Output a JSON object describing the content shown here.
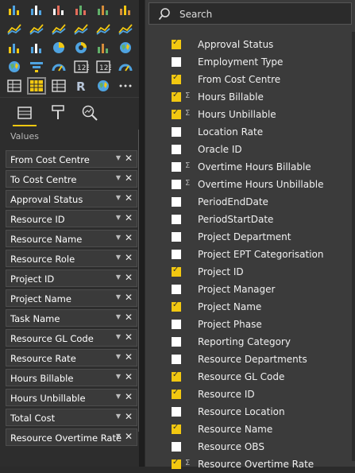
{
  "visualizations": [
    "stacked-bar-icon",
    "clustered-bar-icon",
    "stacked-bar-100-icon",
    "clustered-column-icon",
    "stacked-column-100-icon",
    "clustered-column-2-icon",
    "line-icon",
    "area-icon",
    "stacked-area-icon",
    "line-column-icon",
    "line-stacked-column-icon",
    "ribbon-icon",
    "waterfall-icon",
    "scatter-icon",
    "pie-icon",
    "donut-icon",
    "treemap-icon",
    "map-icon",
    "filled-map-icon",
    "funnel-icon",
    "gauge-icon",
    "card-icon",
    "multirow-card-icon",
    "kpi-icon",
    "slicer-icon",
    "table-icon",
    "matrix-icon",
    "r-script-icon",
    "globe-icon",
    "more-icon"
  ],
  "tabs": [
    "fields-tab-icon",
    "format-tab-icon",
    "analytics-tab-icon"
  ],
  "values_label": "Values",
  "wells": [
    "From Cost Centre",
    "To Cost Centre",
    "Approval Status",
    "Resource ID",
    "Resource Name",
    "Resource Role",
    "Project ID",
    "Project Name",
    "Task Name",
    "Resource GL Code",
    "Resource Rate",
    "Hours Billable",
    "Hours Unbillable",
    "Total Cost",
    "Resource Overtime Rate"
  ],
  "search": {
    "placeholder": "Search"
  },
  "fields": [
    {
      "label": "Approval Status",
      "checked": true,
      "sigma": false
    },
    {
      "label": "Employment Type",
      "checked": false,
      "sigma": false
    },
    {
      "label": "From Cost Centre",
      "checked": true,
      "sigma": false
    },
    {
      "label": "Hours Billable",
      "checked": true,
      "sigma": true
    },
    {
      "label": "Hours Unbillable",
      "checked": true,
      "sigma": true
    },
    {
      "label": "Location Rate",
      "checked": false,
      "sigma": false
    },
    {
      "label": "Oracle ID",
      "checked": false,
      "sigma": false
    },
    {
      "label": "Overtime Hours Billable",
      "checked": false,
      "sigma": true
    },
    {
      "label": "Overtime Hours Unbillable",
      "checked": false,
      "sigma": true
    },
    {
      "label": "PeriodEndDate",
      "checked": false,
      "sigma": false
    },
    {
      "label": "PeriodStartDate",
      "checked": false,
      "sigma": false
    },
    {
      "label": "Project Department",
      "checked": false,
      "sigma": false
    },
    {
      "label": "Project EPT Categorisation",
      "checked": false,
      "sigma": false
    },
    {
      "label": "Project ID",
      "checked": true,
      "sigma": false
    },
    {
      "label": "Project Manager",
      "checked": false,
      "sigma": false
    },
    {
      "label": "Project Name",
      "checked": true,
      "sigma": false
    },
    {
      "label": "Project Phase",
      "checked": false,
      "sigma": false
    },
    {
      "label": "Reporting Category",
      "checked": false,
      "sigma": false
    },
    {
      "label": "Resource Departments",
      "checked": false,
      "sigma": false
    },
    {
      "label": "Resource GL Code",
      "checked": true,
      "sigma": false
    },
    {
      "label": "Resource ID",
      "checked": true,
      "sigma": false
    },
    {
      "label": "Resource Location",
      "checked": false,
      "sigma": false
    },
    {
      "label": "Resource Name",
      "checked": true,
      "sigma": false
    },
    {
      "label": "Resource OBS",
      "checked": false,
      "sigma": false
    },
    {
      "label": "Resource Overtime Rate",
      "checked": true,
      "sigma": true
    }
  ],
  "colors": {
    "accent": "#f2c811",
    "sidebar": "#2d2d2d",
    "panel": "#3b3b3b"
  }
}
